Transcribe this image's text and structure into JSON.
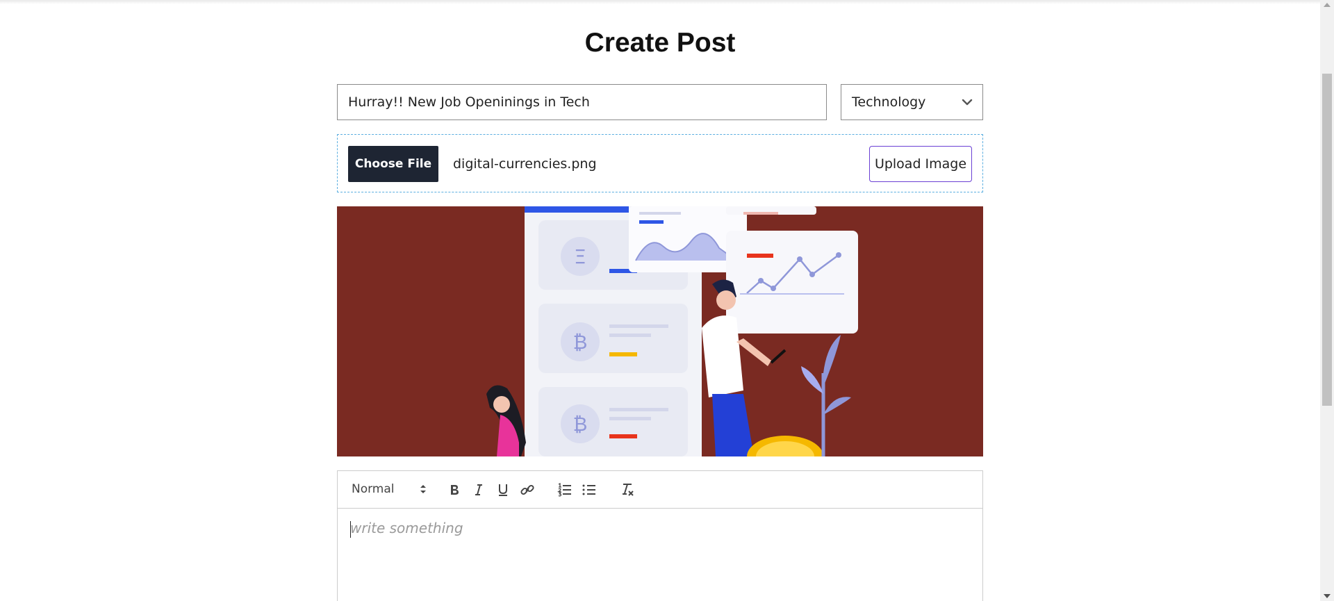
{
  "page": {
    "title": "Create Post"
  },
  "form": {
    "title_value": "Hurray!! New Job Openinings in Tech",
    "category_value": "Technology",
    "choose_file_label": "Choose File",
    "file_name": "digital-currencies.png",
    "upload_label": "Upload Image"
  },
  "preview": {
    "alt": "digital currencies illustration",
    "background_color": "#7a2a22",
    "coin_labels": [
      "Ξ",
      "₿",
      "₿"
    ]
  },
  "editor": {
    "format_value": "Normal",
    "placeholder": "write something",
    "toolbar_icons": [
      "bold-icon",
      "italic-icon",
      "underline-icon",
      "link-icon",
      "ordered-list-icon",
      "bullet-list-icon",
      "clear-format-icon"
    ]
  },
  "colors": {
    "choose_button_bg": "#1e2533",
    "upload_button_border": "#6a3fd4",
    "upload_row_border": "#5aaee0"
  }
}
